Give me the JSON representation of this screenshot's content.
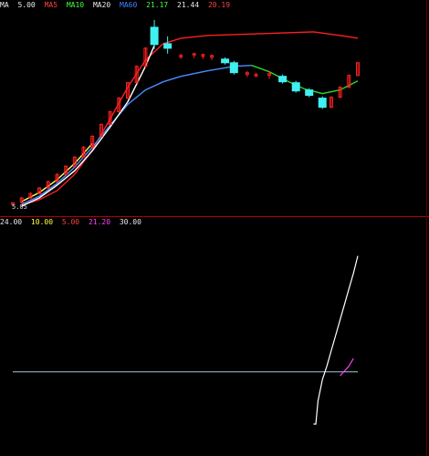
{
  "header": {
    "segments": [
      {
        "text": "MA",
        "color": "#e8e8e8"
      },
      {
        "text": "5.00",
        "color": "#e8e8e8"
      },
      {
        "text": "MA5",
        "color": "#ff4040"
      },
      {
        "text": "MA10",
        "color": "#40ff40"
      },
      {
        "text": "MA20",
        "color": "#e8e8e8"
      },
      {
        "text": "MA60",
        "color": "#4080ff"
      },
      {
        "text": "21.17",
        "color": "#40ff40"
      },
      {
        "text": "21.44",
        "color": "#e8e8e8"
      },
      {
        "text": "20.19",
        "color": "#ff4040"
      }
    ]
  },
  "price_axis_low_label": "5.05",
  "subchart_header": {
    "segments": [
      {
        "text": "24.00",
        "color": "#e8e8e8"
      },
      {
        "text": "10.00",
        "color": "#ffff40"
      },
      {
        "text": "5.00",
        "color": "#ff4040"
      },
      {
        "text": "21.20",
        "color": "#ff40ff"
      },
      {
        "text": "30.00",
        "color": "#e8e8e8"
      }
    ]
  },
  "colors": {
    "background": "#000000",
    "up_candle": "#ff2020",
    "down_candle": "#40f0f0",
    "ma_red": "#ff2020",
    "ma_blue": "#4a8cff",
    "ma_green": "#30d030",
    "ma_yellow": "#ffff60",
    "ma_white": "#ffffff",
    "divider": "#b00000",
    "gridline": "#a0c8e0",
    "signal_pink": "#ff60c0"
  },
  "chart_data": [
    {
      "type": "line",
      "subtype": "candlestick",
      "ylim": [
        5.0,
        26.0
      ],
      "price_low_label": 5.05,
      "x_index_range": [
        0,
        78
      ],
      "candles": [
        {
          "i": 0,
          "open": 5.3,
          "high": 5.5,
          "low": 5.05,
          "close": 5.45,
          "dir": "up"
        },
        {
          "i": 2,
          "open": 5.5,
          "high": 6.1,
          "low": 5.4,
          "close": 6.0,
          "dir": "up"
        },
        {
          "i": 4,
          "open": 6.0,
          "high": 6.6,
          "low": 5.9,
          "close": 6.5,
          "dir": "up"
        },
        {
          "i": 6,
          "open": 6.5,
          "high": 7.2,
          "low": 6.4,
          "close": 7.1,
          "dir": "up"
        },
        {
          "i": 8,
          "open": 7.1,
          "high": 7.9,
          "low": 7.0,
          "close": 7.8,
          "dir": "up"
        },
        {
          "i": 10,
          "open": 7.8,
          "high": 8.7,
          "low": 7.7,
          "close": 8.6,
          "dir": "up"
        },
        {
          "i": 12,
          "open": 8.6,
          "high": 9.6,
          "low": 8.5,
          "close": 9.5,
          "dir": "up"
        },
        {
          "i": 14,
          "open": 9.5,
          "high": 10.6,
          "low": 9.4,
          "close": 10.5,
          "dir": "up"
        },
        {
          "i": 16,
          "open": 10.5,
          "high": 11.7,
          "low": 10.4,
          "close": 11.6,
          "dir": "up"
        },
        {
          "i": 18,
          "open": 11.6,
          "high": 12.9,
          "low": 11.5,
          "close": 12.8,
          "dir": "up"
        },
        {
          "i": 20,
          "open": 12.8,
          "high": 14.2,
          "low": 12.7,
          "close": 14.1,
          "dir": "up"
        },
        {
          "i": 22,
          "open": 14.1,
          "high": 15.6,
          "low": 14.0,
          "close": 15.5,
          "dir": "up"
        },
        {
          "i": 24,
          "open": 15.5,
          "high": 17.1,
          "low": 15.4,
          "close": 17.0,
          "dir": "up"
        },
        {
          "i": 26,
          "open": 17.0,
          "high": 18.8,
          "low": 16.9,
          "close": 18.7,
          "dir": "up"
        },
        {
          "i": 28,
          "open": 18.7,
          "high": 20.6,
          "low": 18.6,
          "close": 20.5,
          "dir": "up"
        },
        {
          "i": 30,
          "open": 20.5,
          "high": 22.6,
          "low": 20.4,
          "close": 22.5,
          "dir": "up"
        },
        {
          "i": 32,
          "open": 24.8,
          "high": 25.6,
          "low": 22.4,
          "close": 22.9,
          "dir": "down"
        },
        {
          "i": 35,
          "open": 23.0,
          "high": 23.8,
          "low": 21.9,
          "close": 22.5,
          "dir": "down"
        },
        {
          "i": 38,
          "open": 21.6,
          "high": 21.9,
          "low": 21.3,
          "close": 21.7,
          "dir": "up"
        },
        {
          "i": 41,
          "open": 21.8,
          "high": 22.0,
          "low": 21.4,
          "close": 21.9,
          "dir": "up"
        },
        {
          "i": 43,
          "open": 21.6,
          "high": 21.9,
          "low": 21.3,
          "close": 21.8,
          "dir": "up"
        },
        {
          "i": 45,
          "open": 21.5,
          "high": 21.8,
          "low": 21.2,
          "close": 21.7,
          "dir": "up"
        },
        {
          "i": 48,
          "open": 21.3,
          "high": 21.5,
          "low": 20.7,
          "close": 20.9,
          "dir": "down"
        },
        {
          "i": 50,
          "open": 20.9,
          "high": 21.1,
          "low": 19.6,
          "close": 19.8,
          "dir": "down"
        },
        {
          "i": 53,
          "open": 19.8,
          "high": 20.0,
          "low": 19.3,
          "close": 19.6,
          "dir": "up"
        },
        {
          "i": 55,
          "open": 19.6,
          "high": 19.8,
          "low": 19.3,
          "close": 19.5,
          "dir": "up"
        },
        {
          "i": 58,
          "open": 19.5,
          "high": 20.0,
          "low": 19.1,
          "close": 19.7,
          "dir": "up"
        },
        {
          "i": 61,
          "open": 19.4,
          "high": 19.6,
          "low": 18.6,
          "close": 18.8,
          "dir": "down"
        },
        {
          "i": 64,
          "open": 18.7,
          "high": 18.9,
          "low": 17.6,
          "close": 17.8,
          "dir": "down"
        },
        {
          "i": 67,
          "open": 17.9,
          "high": 18.1,
          "low": 17.1,
          "close": 17.3,
          "dir": "down"
        },
        {
          "i": 70,
          "open": 17.0,
          "high": 17.2,
          "low": 15.8,
          "close": 16.0,
          "dir": "down"
        },
        {
          "i": 72,
          "open": 16.0,
          "high": 17.2,
          "low": 15.9,
          "close": 17.1,
          "dir": "up"
        },
        {
          "i": 74,
          "open": 17.1,
          "high": 18.3,
          "low": 17.0,
          "close": 18.2,
          "dir": "up"
        },
        {
          "i": 76,
          "open": 18.2,
          "high": 19.6,
          "low": 18.1,
          "close": 19.5,
          "dir": "up"
        },
        {
          "i": 78,
          "open": 19.5,
          "high": 21.0,
          "low": 19.4,
          "close": 20.9,
          "dir": "up"
        }
      ],
      "series": [
        {
          "color": "#ff2020",
          "x": [
            2,
            6,
            10,
            14,
            18,
            22,
            26,
            30,
            34,
            38,
            44,
            50,
            56,
            62,
            68,
            74,
            78
          ],
          "y": [
            5.2,
            5.8,
            6.8,
            8.6,
            11.3,
            14.7,
            18.2,
            21.2,
            23.0,
            23.6,
            23.9,
            24.0,
            24.1,
            24.2,
            24.3,
            23.9,
            23.6
          ]
        },
        {
          "color": "#4a8cff",
          "x": [
            2,
            6,
            10,
            14,
            18,
            22,
            26,
            30,
            34,
            38,
            44,
            50,
            54
          ],
          "y": [
            5.3,
            6.2,
            7.6,
            9.4,
            11.6,
            14.0,
            16.3,
            17.9,
            18.8,
            19.4,
            20.0,
            20.5,
            20.6
          ]
        },
        {
          "color": "#30d030",
          "x": [
            54,
            58,
            62,
            66,
            70,
            74,
            78
          ],
          "y": [
            20.6,
            19.9,
            18.9,
            18.0,
            17.5,
            17.9,
            18.9
          ]
        },
        {
          "color": "#ffff60",
          "x": [
            2,
            6,
            10,
            14,
            18
          ],
          "y": [
            5.6,
            6.6,
            8.0,
            9.8,
            12.0
          ]
        },
        {
          "color": "#ffffff",
          "x": [
            2,
            6,
            10,
            14,
            18,
            22,
            26,
            30,
            32
          ],
          "y": [
            5.1,
            6.0,
            7.4,
            9.0,
            11.2,
            13.8,
            16.6,
            20.5,
            22.8
          ]
        }
      ],
      "grid": false
    },
    {
      "type": "line",
      "subtype": "indicator",
      "ylim": [
        0,
        100
      ],
      "x_index_range": [
        0,
        78
      ],
      "reference_level": 35,
      "series": [
        {
          "color": "#ffffff",
          "x": [
            68,
            68.5,
            69,
            70,
            71,
            72,
            73,
            74,
            75,
            76,
            77,
            78
          ],
          "y": [
            8,
            8,
            20,
            31,
            38,
            46,
            54,
            62,
            70,
            78,
            86,
            95
          ]
        },
        {
          "color": "#ff40ff",
          "x": [
            74,
            76,
            77
          ],
          "y": [
            33,
            38,
            42
          ]
        }
      ],
      "grid": false
    }
  ]
}
